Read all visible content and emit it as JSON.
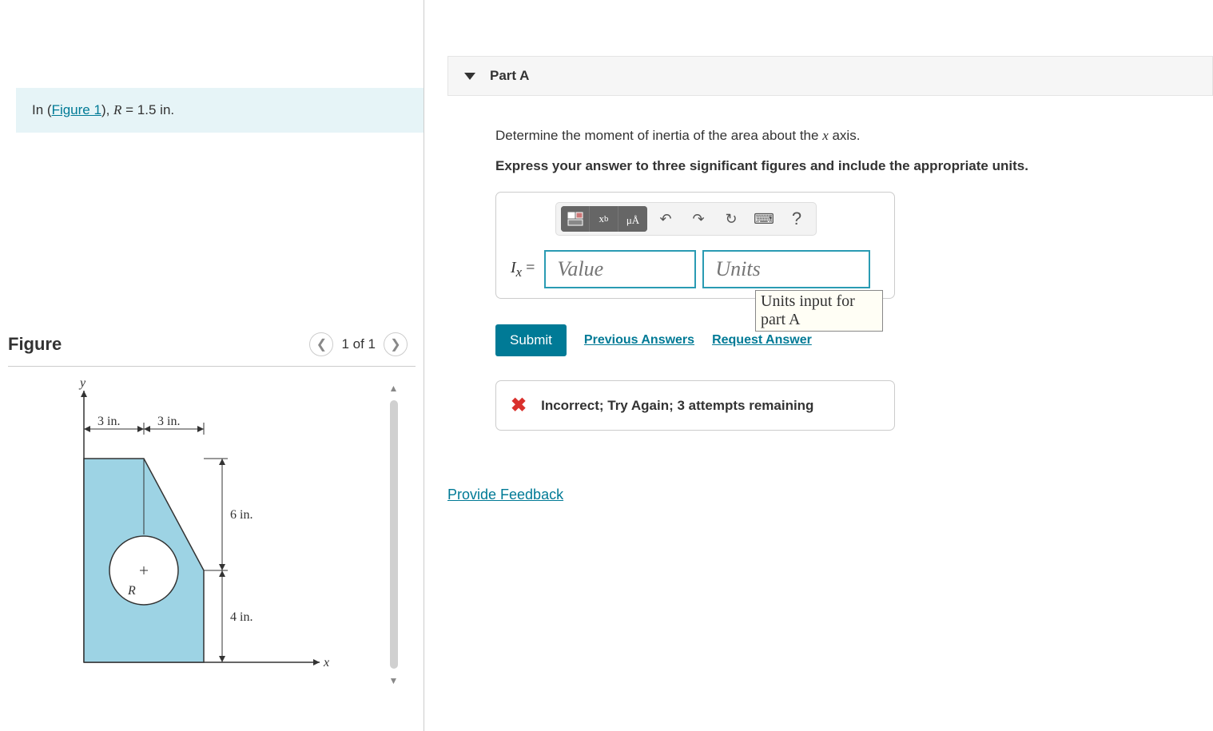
{
  "problem": {
    "prefix": "In (",
    "figure_link": "Figure 1",
    "suffix": "), R = 1.5 in."
  },
  "figure_panel": {
    "title": "Figure",
    "counter": "1 of 1"
  },
  "figure_labels": {
    "y_axis": "y",
    "x_axis": "x",
    "dim_3in_left": "3 in.",
    "dim_3in_right": "3 in.",
    "dim_6in": "6 in.",
    "dim_4in": "4 in.",
    "radius_label": "R"
  },
  "part": {
    "label": "Part A",
    "question_prefix": "Determine the moment of inertia of the area about the ",
    "question_var": "x",
    "question_suffix": " axis.",
    "instruction": "Express your answer to three significant figures and include the appropriate units."
  },
  "answer": {
    "lhs_var": "I",
    "lhs_sub": "x",
    "equals": " = ",
    "value_placeholder": "Value",
    "units_placeholder": "Units",
    "units_tooltip": "Units input for part A"
  },
  "toolbar": {
    "undo": "↶",
    "redo": "↷",
    "reset": "↻",
    "keyboard": "⌨",
    "help": "?"
  },
  "actions": {
    "submit": "Submit",
    "previous": "Previous Answers",
    "request": "Request Answer"
  },
  "feedback": {
    "message": "Incorrect; Try Again; 3 attempts remaining"
  },
  "footer": {
    "provide_feedback": "Provide Feedback"
  }
}
